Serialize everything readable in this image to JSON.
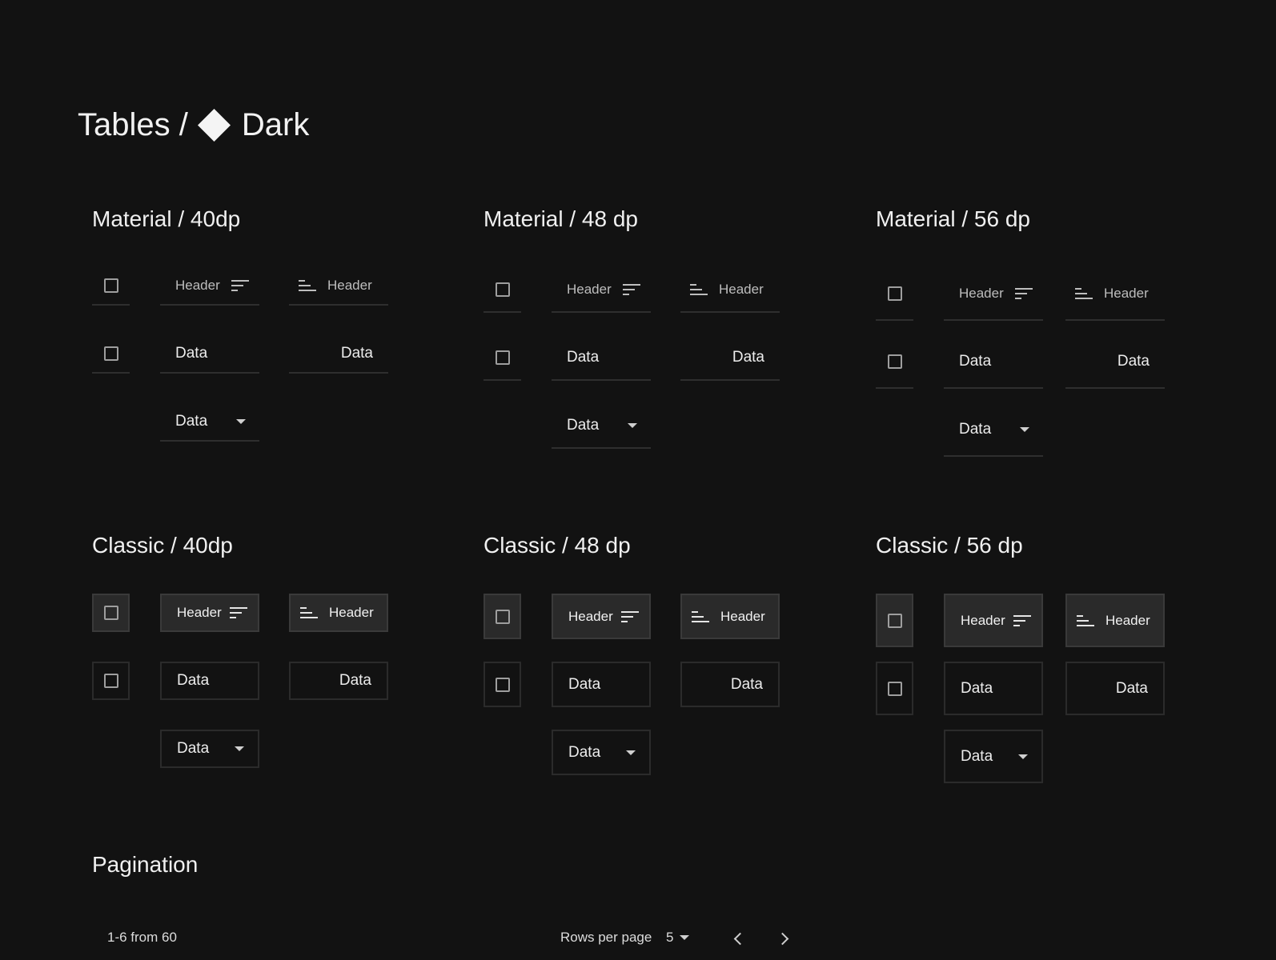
{
  "page": {
    "title_prefix": "Tables /",
    "title_suffix": "Dark"
  },
  "sections": {
    "material_40": {
      "title": "Material / 40dp"
    },
    "material_48": {
      "title": "Material / 48 dp"
    },
    "material_56": {
      "title": "Material / 56 dp"
    },
    "classic_40": {
      "title": "Classic / 40dp"
    },
    "classic_48": {
      "title": "Classic / 48 dp"
    },
    "classic_56": {
      "title": "Classic / 56 dp"
    },
    "pagination": {
      "title": "Pagination"
    }
  },
  "table": {
    "header_label": "Header",
    "data_label": "Data",
    "icons": {
      "header_sort_right": "sort-descending-icon",
      "header_sort_left": "sort-ascending-icon",
      "dropdown": "caret-down-icon",
      "checkbox": "checkbox-icon"
    }
  },
  "pagination": {
    "range_text": "1-6 from 60",
    "rows_per_page_label": "Rows per page",
    "rows_per_page_value": "5",
    "icons": {
      "prev": "chevron-left-icon",
      "next": "chevron-right-icon"
    }
  },
  "colors": {
    "background": "#121212",
    "text": "#ececec",
    "classic_header_bg": "#2a2a2a",
    "divider": "#2e2e2e"
  }
}
